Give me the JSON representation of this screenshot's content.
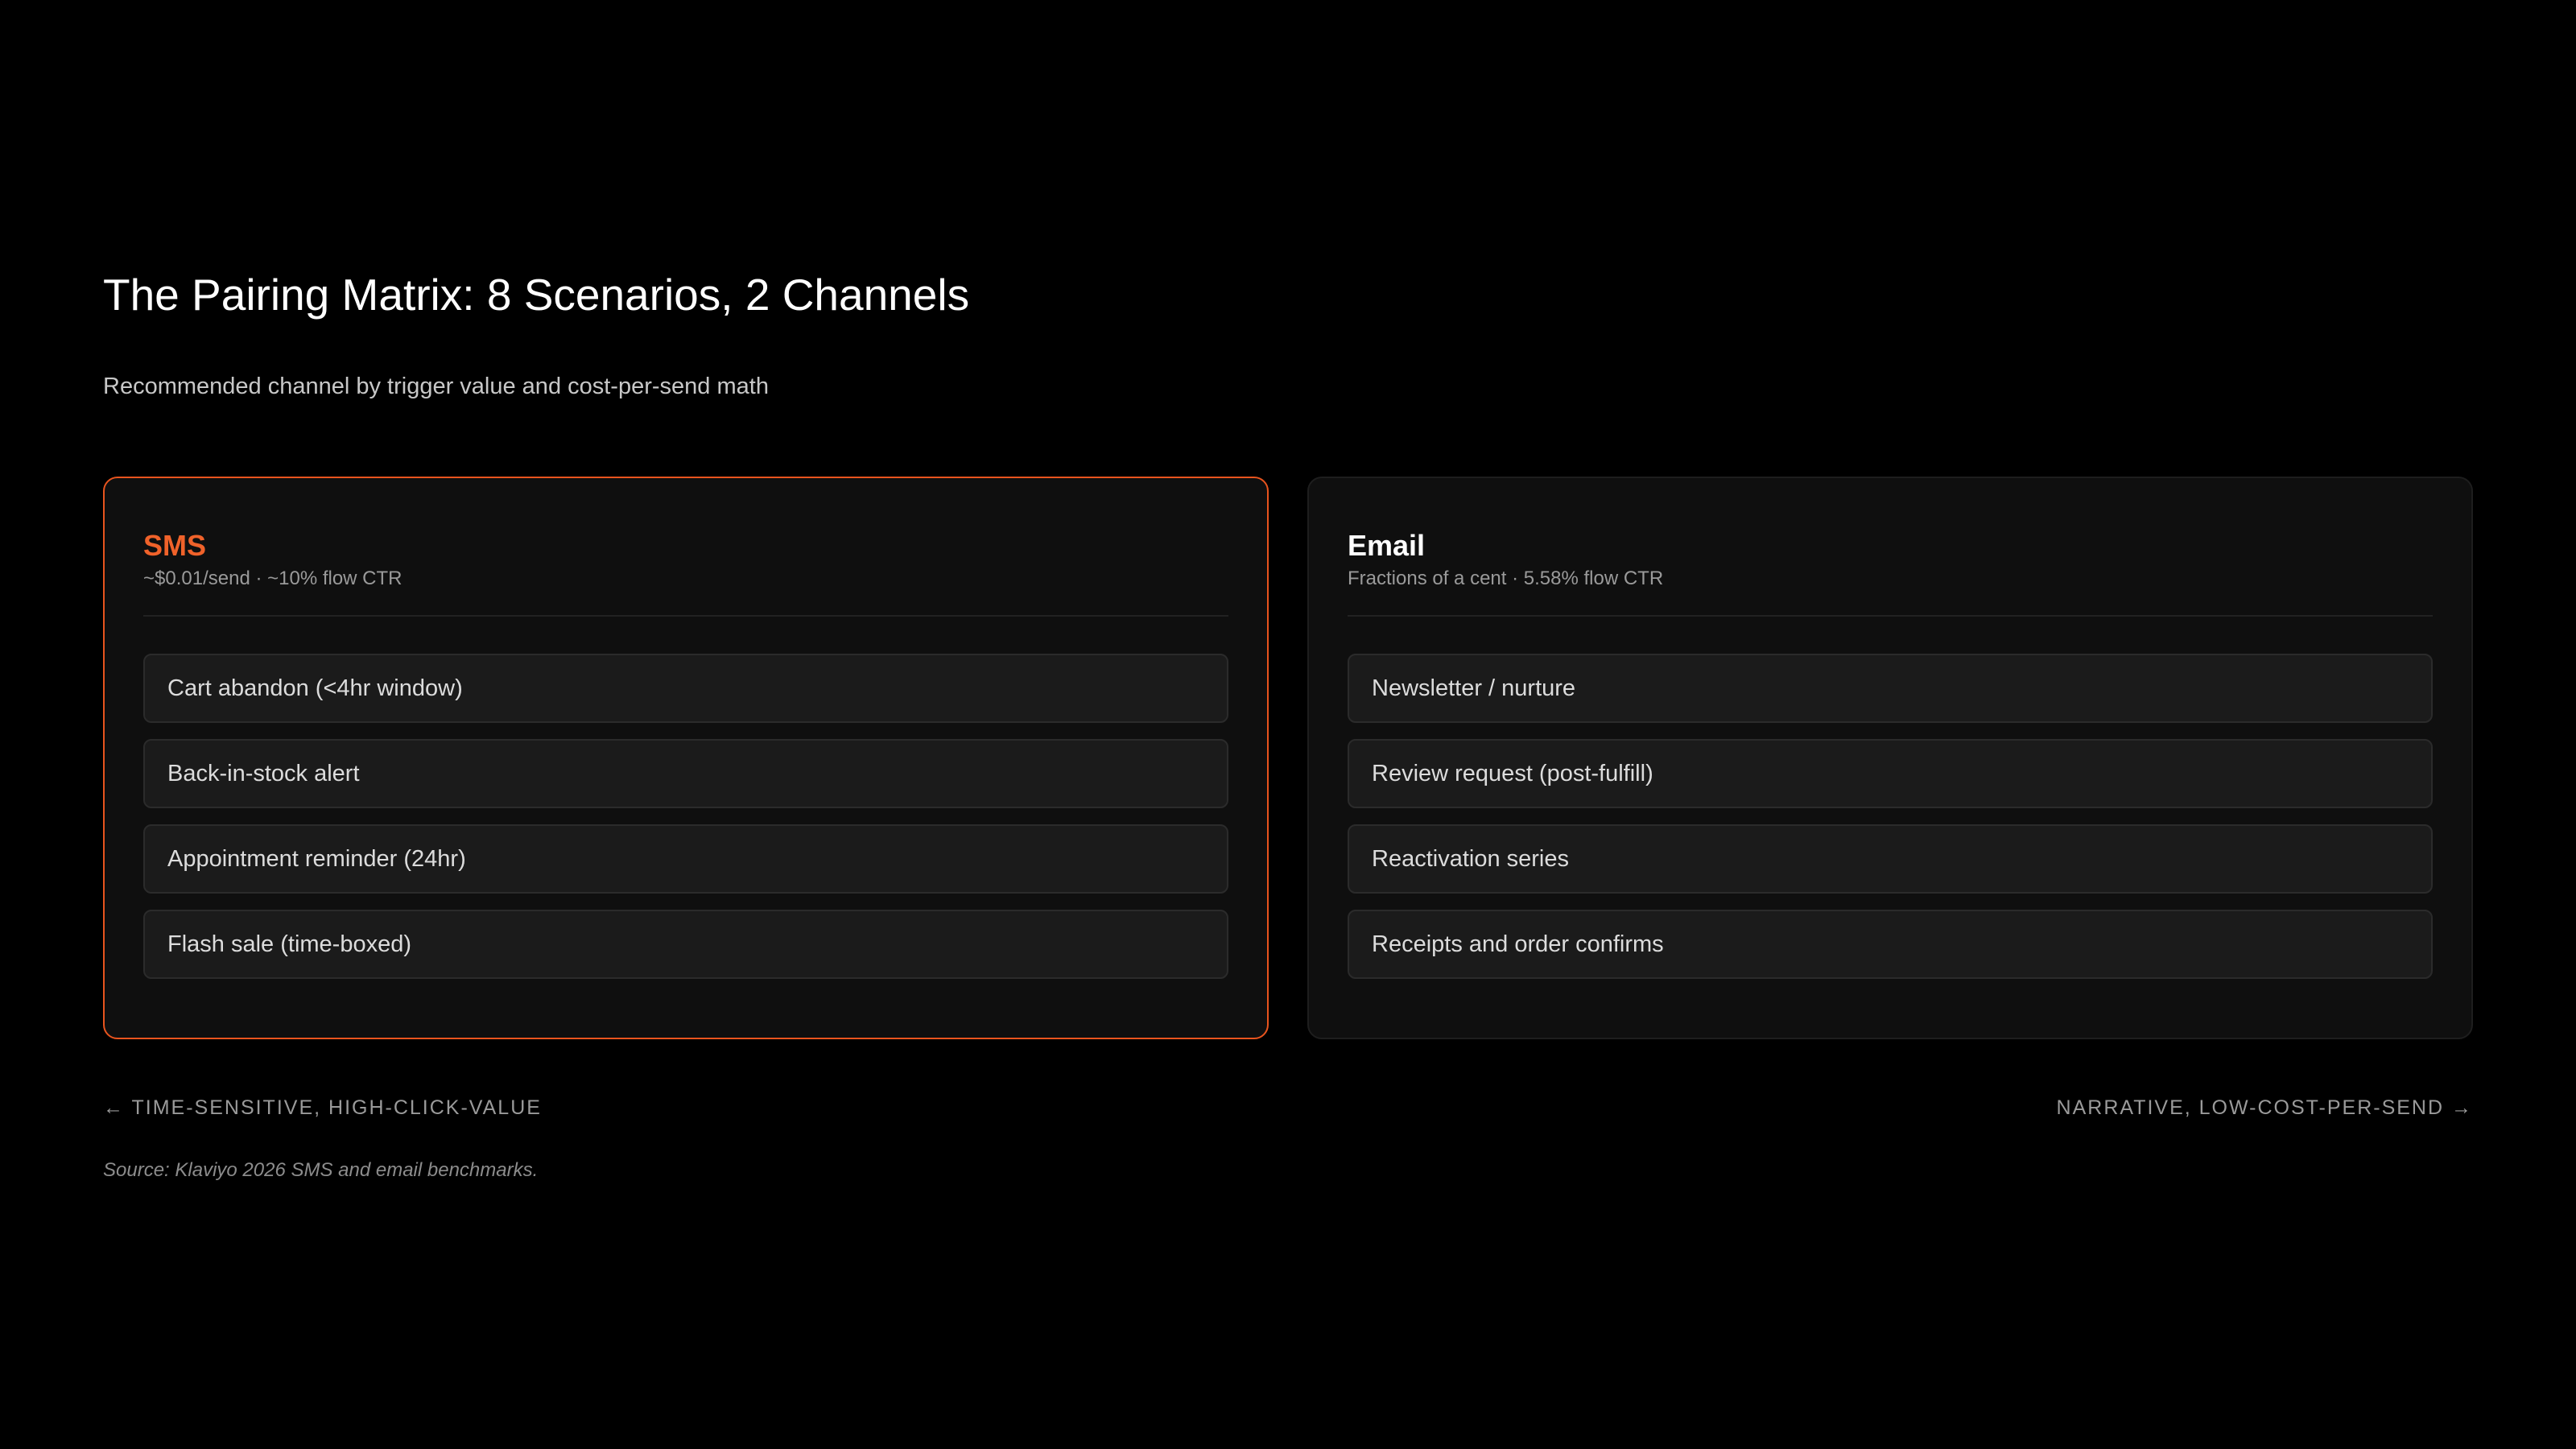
{
  "header": {
    "title": "The Pairing Matrix: 8 Scenarios, 2 Channels",
    "subtitle": "Recommended channel by trigger value and cost-per-send math"
  },
  "channels": [
    {
      "name": "SMS",
      "meta": "~$0.01/send · ~10% flow CTR",
      "accent": "#f0622a",
      "scenarios": [
        "Cart abandon (<4hr window)",
        "Back-in-stock alert",
        "Appointment reminder (24hr)",
        "Flash sale (time-boxed)"
      ]
    },
    {
      "name": "Email",
      "meta": "Fractions of a cent · 5.58% flow CTR",
      "accent": "#ffffff",
      "scenarios": [
        "Newsletter / nurture",
        "Review request (post-fulfill)",
        "Reactivation series",
        "Receipts and order confirms"
      ]
    }
  ],
  "axis": {
    "left": "← TIME-SENSITIVE, HIGH-CLICK-VALUE",
    "right": "NARRATIVE, LOW-COST-PER-SEND →"
  },
  "source": "Source: Klaviyo 2026 SMS and email benchmarks.",
  "colors": {
    "background": "#000000",
    "card_background": "#0f0f0f",
    "highlight_border": "#e8541e",
    "item_background": "#1b1b1b"
  }
}
